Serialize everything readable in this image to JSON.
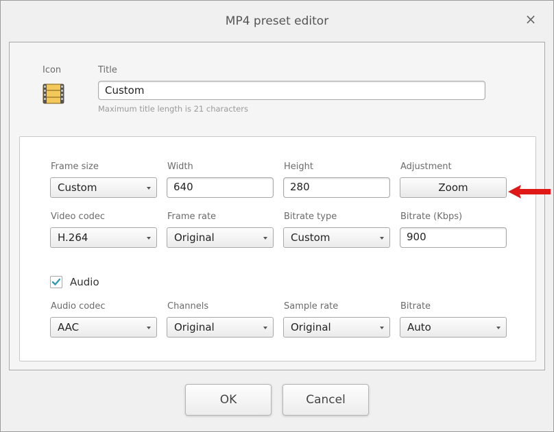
{
  "dialog": {
    "title": "MP4 preset editor",
    "close_label": "×"
  },
  "header": {
    "icon_label": "Icon",
    "icon": "film-strip-icon",
    "title_label": "Title",
    "title_value": "Custom",
    "title_hint": "Maximum title length is 21 characters"
  },
  "video": {
    "frame_size_label": "Frame size",
    "frame_size_value": "Custom",
    "width_label": "Width",
    "width_value": "640",
    "height_label": "Height",
    "height_value": "280",
    "adjustment_label": "Adjustment",
    "adjustment_button": "Zoom",
    "codec_label": "Video codec",
    "codec_value": "H.264",
    "frame_rate_label": "Frame rate",
    "frame_rate_value": "Original",
    "bitrate_type_label": "Bitrate type",
    "bitrate_type_value": "Custom",
    "bitrate_label": "Bitrate (Kbps)",
    "bitrate_value": "900"
  },
  "audio": {
    "enabled_label": "Audio",
    "enabled": true,
    "codec_label": "Audio codec",
    "codec_value": "AAC",
    "channels_label": "Channels",
    "channels_value": "Original",
    "sample_rate_label": "Sample rate",
    "sample_rate_value": "Original",
    "bitrate_label": "Bitrate",
    "bitrate_value": "Auto"
  },
  "footer": {
    "ok_label": "OK",
    "cancel_label": "Cancel"
  },
  "colors": {
    "checkmark": "#2a9db5",
    "annotation_arrow": "#e01818"
  }
}
